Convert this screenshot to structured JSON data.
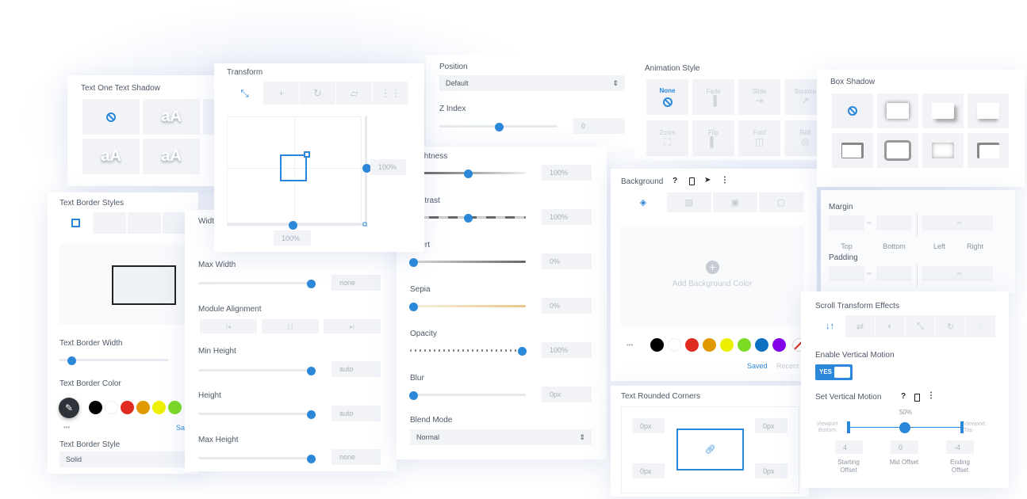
{
  "text_shadow": {
    "title": "Text One Text Shadow",
    "preset_glyph": "aA",
    "icons": [
      "none-icon"
    ]
  },
  "text_border": {
    "title": "Text Border Styles",
    "width_label": "Text Border Width",
    "color_label": "Text Border Color",
    "more": "•••",
    "saved_partial": "Sa",
    "style_label": "Text Border Style",
    "style_value": "Solid",
    "swatches": [
      "#000000",
      "#ffffff",
      "#e02b20",
      "#e09900",
      "#edf000",
      "#7cda24"
    ]
  },
  "sizing": {
    "width_label": "Width",
    "max_width_label": "Max Width",
    "max_width_value": "none",
    "alignment_label": "Module Alignment",
    "alignment_options": [
      "left",
      "center",
      "right"
    ],
    "min_height_label": "Min Height",
    "min_height_value": "auto",
    "height_label": "Height",
    "height_value": "auto",
    "max_height_label": "Max Height",
    "max_height_value": "none"
  },
  "transform": {
    "title": "Transform",
    "tabs": [
      "scale",
      "translate",
      "rotate",
      "skew",
      "origin"
    ],
    "scale_y": "100%",
    "scale_x": "100%"
  },
  "position": {
    "label": "Position",
    "value": "Default",
    "zindex_label": "Z Index",
    "zindex_value": "0"
  },
  "filters": {
    "brightness_label": "Brightness",
    "brightness_value": "100%",
    "contrast_label": "Contrast",
    "contrast_value": "100%",
    "invert_label": "Invert",
    "invert_value": "0%",
    "sepia_label": "Sepia",
    "sepia_value": "0%",
    "opacity_label": "Opacity",
    "opacity_value": "100%",
    "blur_label": "Blur",
    "blur_value": "0px",
    "blend_label": "Blend Mode",
    "blend_value": "Normal"
  },
  "animation": {
    "title": "Animation Style",
    "styles": [
      "None",
      "Fade",
      "Slide",
      "Bounce",
      "Zoom",
      "Flip",
      "Fold",
      "Roll"
    ],
    "selected": "None"
  },
  "background": {
    "title": "Background",
    "help": "?",
    "tabs": [
      "color",
      "gradient",
      "image",
      "video"
    ],
    "add_label": "Add Background Color",
    "plus": "+",
    "more": "•••",
    "swatches": [
      "#000000",
      "#ffffff",
      "#e02b20",
      "#e09900",
      "#edf000",
      "#7cda24",
      "#0c71c3",
      "#8300e9"
    ],
    "saved": "Saved",
    "recent": "Recent"
  },
  "box_shadow": {
    "title": "Box Shadow"
  },
  "spacing": {
    "margin_label": "Margin",
    "padding_label": "Padding",
    "sides": [
      "Top",
      "Bottom",
      "Left",
      "Right"
    ]
  },
  "scroll": {
    "title": "Scroll Transform Effects",
    "tabs": [
      "vertical-motion",
      "horizontal-motion",
      "fading",
      "scaling",
      "rotating",
      "blur"
    ],
    "enable_label": "Enable Vertical Motion",
    "toggle": "YES",
    "set_label": "Set Vertical Motion",
    "help": "?",
    "mid_percent": "50%",
    "viewport_bottom": "Viewport Bottom",
    "viewport_top": "Viewport Top",
    "start_value": "4",
    "mid_value": "0",
    "end_value": "-4",
    "start_label": "Starting Offset",
    "mid_label": "Mid Offset",
    "end_label": "Ending Offset"
  },
  "corners": {
    "title": "Text Rounded Corners",
    "values": [
      "0px",
      "0px",
      "0px",
      "0px"
    ]
  },
  "colors": {
    "accent": "#2b87da"
  }
}
